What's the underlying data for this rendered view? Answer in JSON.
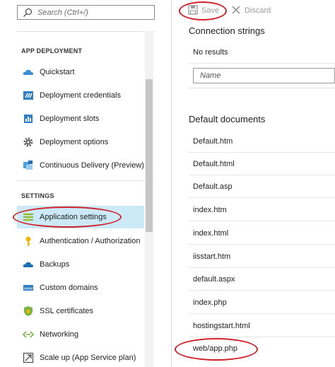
{
  "search": {
    "placeholder": "Search (Ctrl+/)"
  },
  "sections": {
    "app_deployment": "APP DEPLOYMENT",
    "settings": "SETTINGS"
  },
  "deployment_items": [
    {
      "label": "Quickstart",
      "icon": "cloud-icon"
    },
    {
      "label": "Deployment credentials",
      "icon": "credentials-icon"
    },
    {
      "label": "Deployment slots",
      "icon": "slots-icon"
    },
    {
      "label": "Deployment options",
      "icon": "gear-icon"
    },
    {
      "label": "Continuous Delivery (Preview)",
      "icon": "delivery-icon"
    }
  ],
  "settings_items": [
    {
      "label": "Application settings",
      "icon": "app-settings-icon",
      "selected": true
    },
    {
      "label": "Authentication / Authorization",
      "icon": "key-icon"
    },
    {
      "label": "Backups",
      "icon": "cloud-backup-icon"
    },
    {
      "label": "Custom domains",
      "icon": "domains-icon"
    },
    {
      "label": "SSL certificates",
      "icon": "shield-icon"
    },
    {
      "label": "Networking",
      "icon": "networking-icon"
    },
    {
      "label": "Scale up (App Service plan)",
      "icon": "scale-up-icon"
    }
  ],
  "toolbar": {
    "save_label": "Save",
    "discard_label": "Discard"
  },
  "connection_strings": {
    "title": "Connection strings",
    "empty_text": "No results",
    "name_placeholder": "Name"
  },
  "default_documents": {
    "title": "Default documents",
    "items": [
      "Default.htm",
      "Default.html",
      "Default.asp",
      "index.htm",
      "index.html",
      "iisstart.htm",
      "default.aspx",
      "index.php",
      "hostingstart.html",
      "web/app.php"
    ]
  },
  "colors": {
    "selected_bg": "#cce9f7",
    "annotation_red": "#d0222a",
    "accent_blue": "#2f7fc1"
  }
}
